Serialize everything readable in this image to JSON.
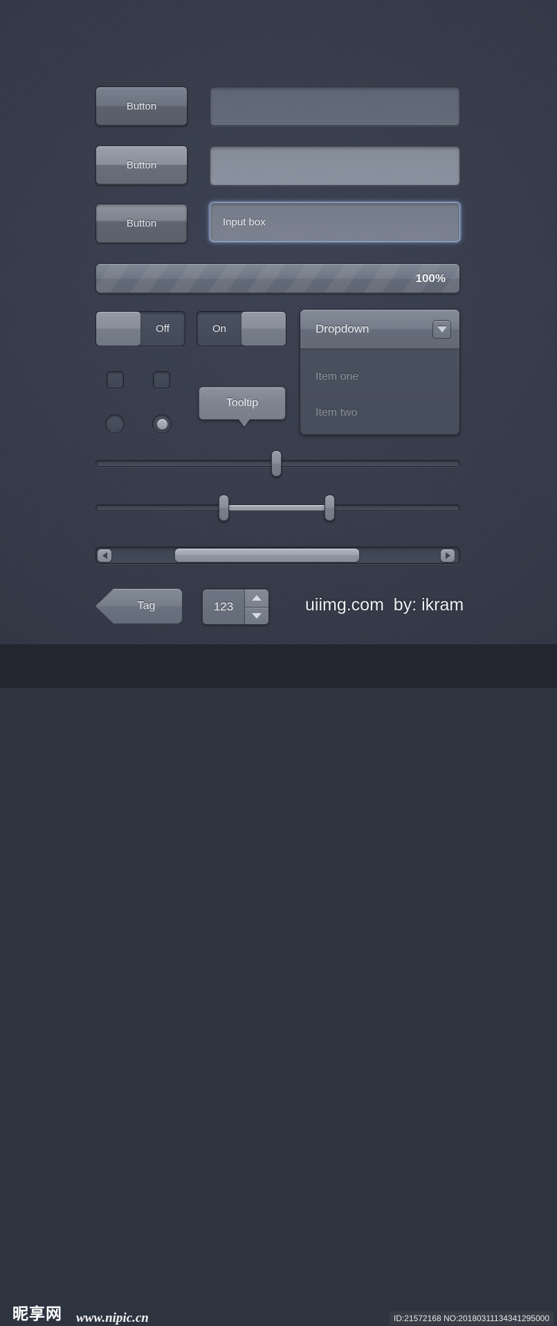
{
  "background": {
    "color": "#353b4b",
    "footer_color": "#23262f"
  },
  "buttons": [
    {
      "label": "Button",
      "state": "normal"
    },
    {
      "label": "Button",
      "state": "hover"
    },
    {
      "label": "Button",
      "state": "active"
    }
  ],
  "inputs": [
    {
      "value": "",
      "placeholder": "",
      "state": "normal"
    },
    {
      "value": "",
      "placeholder": "",
      "state": "light"
    },
    {
      "value": "Input box",
      "placeholder": "Input box",
      "state": "focused"
    }
  ],
  "progress": {
    "label": "100%",
    "value": 100,
    "striped": true
  },
  "toggles": [
    {
      "label": "Off",
      "state": "off",
      "knob_side": "left"
    },
    {
      "label": "On",
      "state": "on",
      "knob_side": "right"
    }
  ],
  "dropdown": {
    "title": "Dropdown",
    "arrow_icon": "chevron-down-icon",
    "items": [
      {
        "label": "Item one"
      },
      {
        "label": "Item two"
      }
    ]
  },
  "checkboxes": [
    {
      "checked": false
    },
    {
      "checked": false
    }
  ],
  "radios": [
    {
      "checked": false
    },
    {
      "checked": true
    }
  ],
  "tooltip": {
    "label": "Tooltip"
  },
  "sliders": [
    {
      "type": "single",
      "value": 50,
      "handles": [
        50
      ]
    },
    {
      "type": "range",
      "values": [
        35,
        64
      ],
      "handles": [
        35,
        64
      ]
    }
  ],
  "scrollbar": {
    "left_arrow_icon": "arrow-left-icon",
    "right_arrow_icon": "arrow-right-icon",
    "thumb_start_pct": 23,
    "thumb_width_pct": 51
  },
  "tag": {
    "label": "Tag"
  },
  "spinner": {
    "value": "123",
    "up_icon": "arrow-up-icon",
    "down_icon": "arrow-down-icon"
  },
  "credit": {
    "text": "uiimg.com  by: ikram"
  },
  "footer": {
    "watermark_cn": "昵享网",
    "watermark_url": "www.nipic.cn",
    "id_text": "ID:21572168 NO:20180311134341295000"
  }
}
